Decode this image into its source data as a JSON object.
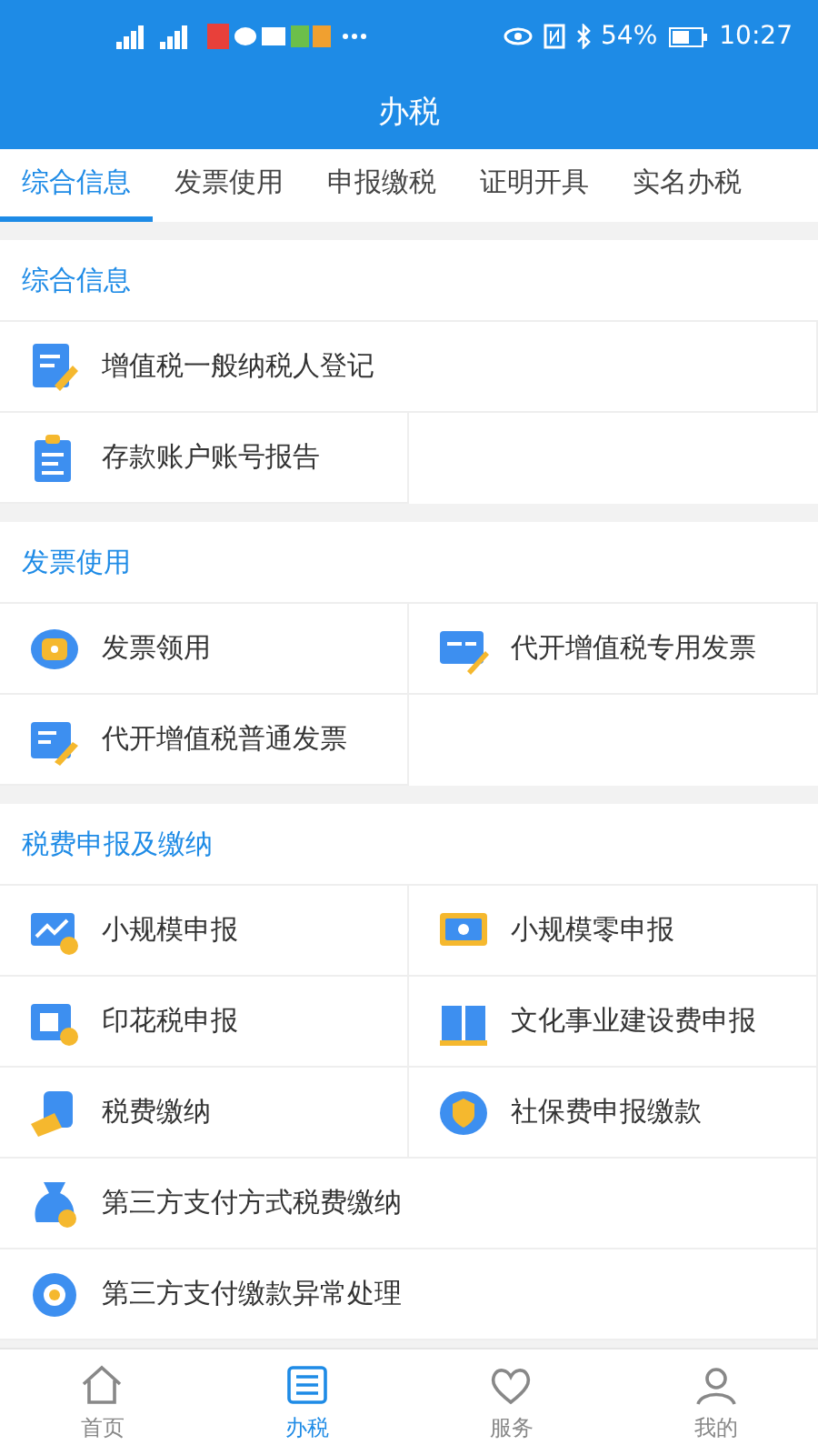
{
  "status_bar": {
    "battery": "54%",
    "time": "10:27"
  },
  "title": "办税",
  "tabs": [
    {
      "label": "综合信息",
      "selected": true
    },
    {
      "label": "发票使用",
      "selected": false
    },
    {
      "label": "申报缴税",
      "selected": false
    },
    {
      "label": "证明开具",
      "selected": false
    },
    {
      "label": "实名办税",
      "selected": false
    }
  ],
  "sections": [
    {
      "title": "综合信息",
      "items": [
        {
          "label": "增值税一般纳税人登记",
          "wide": true
        },
        {
          "label": "存款账户账号报告",
          "wide": false
        }
      ]
    },
    {
      "title": "发票使用",
      "items": [
        {
          "label": "发票领用",
          "wide": false
        },
        {
          "label": "代开增值税专用发票",
          "wide": false
        },
        {
          "label": "代开增值税普通发票",
          "wide": false
        }
      ]
    },
    {
      "title": "税费申报及缴纳",
      "items": [
        {
          "label": "小规模申报",
          "wide": false
        },
        {
          "label": "小规模零申报",
          "wide": false
        },
        {
          "label": "印花税申报",
          "wide": false
        },
        {
          "label": "文化事业建设费申报",
          "wide": false
        },
        {
          "label": "税费缴纳",
          "wide": false
        },
        {
          "label": "社保费申报缴款",
          "wide": false
        },
        {
          "label": "第三方支付方式税费缴纳",
          "wide": true
        },
        {
          "label": "第三方支付缴款异常处理",
          "wide": true
        }
      ]
    }
  ],
  "bottom_nav": [
    {
      "label": "首页",
      "selected": false
    },
    {
      "label": "办税",
      "selected": true
    },
    {
      "label": "服务",
      "selected": false
    },
    {
      "label": "我的",
      "selected": false
    }
  ]
}
